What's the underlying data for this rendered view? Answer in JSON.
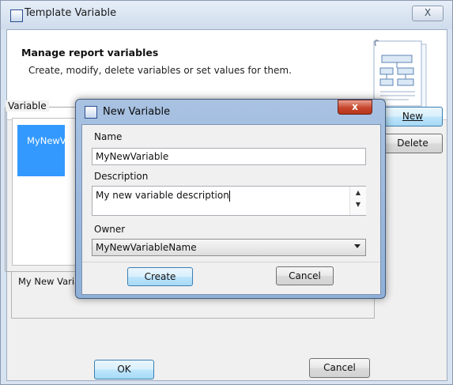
{
  "outer": {
    "title": "Template Variable",
    "close_label": "X",
    "header_title": "Manage report variables",
    "header_subtitle": "Create, modify, delete variables or set values for them.",
    "variable_legend": "Variable",
    "selected_variable": "MyNewVariable",
    "new_button": "New",
    "delete_button": "Delete",
    "description_text": "My New Variable Name",
    "ok_button": "OK",
    "cancel_button": "Cancel"
  },
  "dialog": {
    "title": "New Variable",
    "close_label": "x",
    "name_label": "Name",
    "name_value": "MyNewVariable",
    "description_label": "Description",
    "description_value": "My new variable description",
    "owner_label": "Owner",
    "owner_value": "MyNewVariableName",
    "create_button": "Create",
    "cancel_button": "Cancel"
  },
  "icons": [
    "app-icon",
    "document-illustration-icon",
    "dropdown-arrow-icon",
    "scroll-up-icon",
    "scroll-down-icon"
  ],
  "colors": {
    "selection": "#3399ff",
    "dialog_frame": "#9bb7dd",
    "close_red": "#c7462e"
  }
}
